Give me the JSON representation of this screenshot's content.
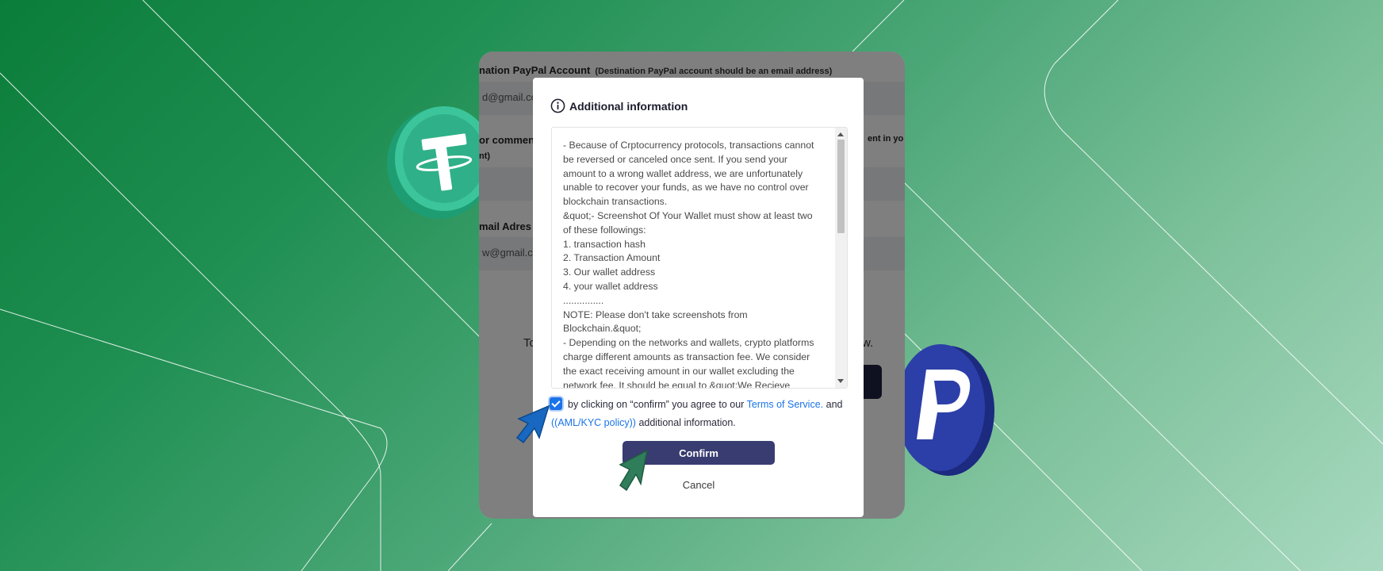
{
  "background_form": {
    "account_label": "nation PayPal Account",
    "account_hint": "(Destination PayPal account should be an email address)",
    "account_value": "d@gmail.co",
    "comment_label": "or commen",
    "comment_hint_right": "ent in yo",
    "comment_hint_second": "nt)",
    "email_label": "mail Adres",
    "email_value": "w@gmail.co",
    "note_left": "To",
    "note_right": "w."
  },
  "modal": {
    "title": "Additional information",
    "body_lines": [
      "- Because of Crptocurrency protocols, transactions cannot",
      "be reversed or canceled once sent. If you send your",
      "amount to a  wrong wallet address, we are unfortunately",
      "unable to recover your funds, as we have no control over",
      "blockchain transactions.",
      "&quot;- Screenshot Of Your Wallet must show at least two",
      "of these followings:",
      "1. transaction hash",
      "2. Transaction Amount",
      "3. Our wallet address",
      "4. your wallet address",
      "...............",
      "NOTE: Please don't take screenshots from",
      "Blockchain.&quot;",
      "- Depending on the networks and wallets, crypto platforms",
      "charge different amounts as transaction fee. We consider",
      "the exact receiving amount in our wallet excluding the",
      "network fee. It should be equal to &quot;We Recieve"
    ],
    "agree_text_before": "by clicking on “confirm” you agree to our",
    "terms_link": "Terms of Service.",
    "agree_and": "and",
    "aml_link": "((AML/KYC policy))",
    "agree_text_after": "additional information.",
    "agree_checked": true,
    "confirm_label": "Confirm",
    "cancel_label": "Cancel"
  },
  "icons": {
    "info": "info-circle-icon",
    "tether_coin": "tether-coin-icon",
    "paypal_coin": "paypal-coin-icon",
    "cursor_blue": "blue-cursor-icon",
    "cursor_green": "green-cursor-icon"
  },
  "colors": {
    "accent": "#1a73e8",
    "confirm_button": "#383c70",
    "background_green": "#0b7d3a"
  }
}
